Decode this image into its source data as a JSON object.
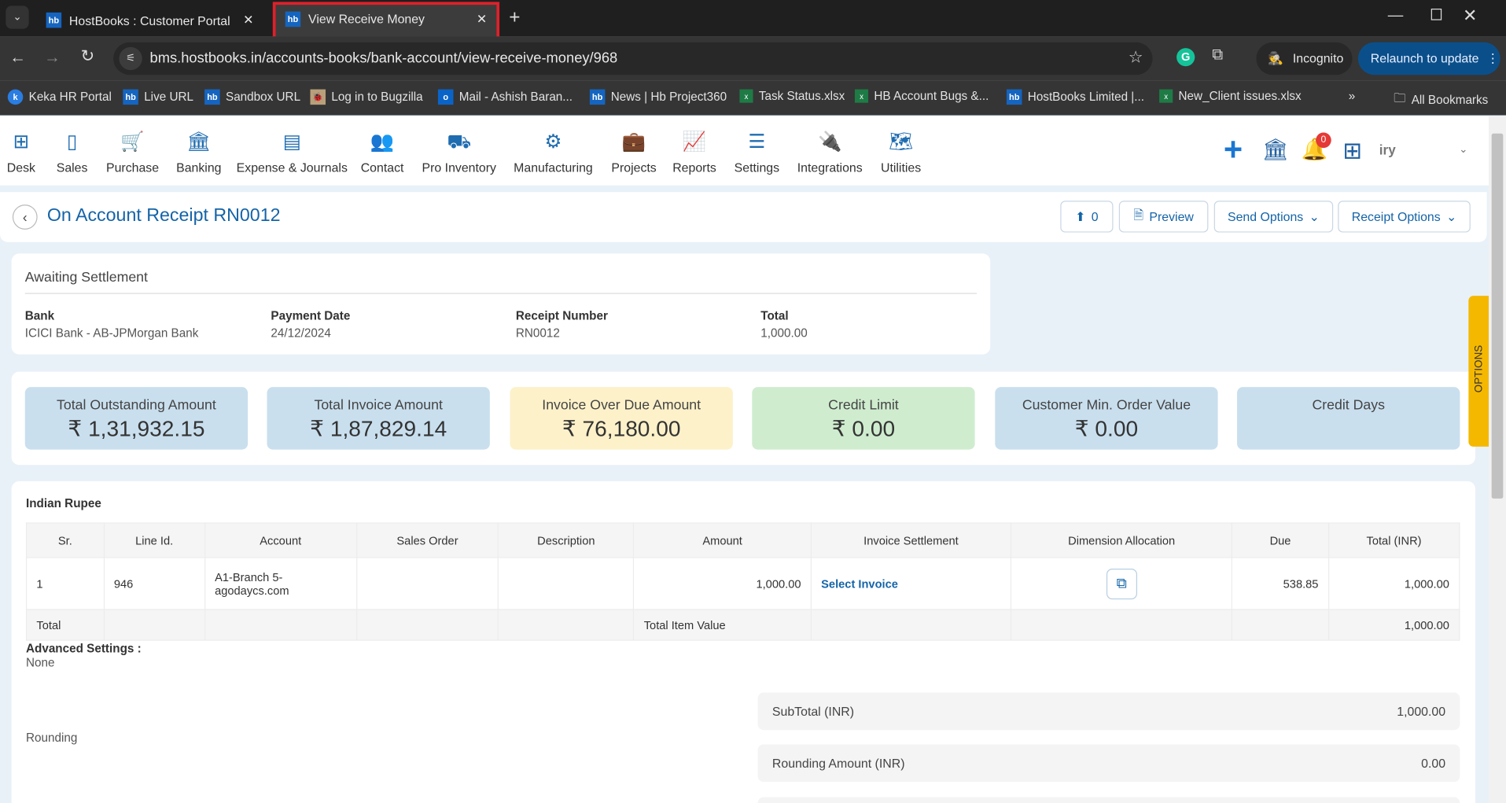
{
  "browser": {
    "tabs": [
      {
        "title": "HostBooks : Customer Portal",
        "active": false
      },
      {
        "title": "View Receive Money",
        "active": true
      }
    ],
    "url": "bms.hostbooks.in/accounts-books/bank-account/view-receive-money/968",
    "incognito": "Incognito",
    "relaunch": "Relaunch to update",
    "bookmarks": [
      "Keka HR Portal",
      "Live URL",
      "Sandbox URL",
      "Log in to Bugzilla",
      "Mail - Ashish Baran...",
      "News | Hb Project360",
      "Task Status.xlsx",
      "HB Account Bugs &...",
      "HostBooks Limited |...",
      "New_Client issues.xlsx"
    ],
    "all_bookmarks": "All Bookmarks"
  },
  "nav": {
    "items": [
      "Desk",
      "Sales",
      "Purchase",
      "Banking",
      "Expense & Journals",
      "Contact",
      "Pro Inventory",
      "Manufacturing",
      "Projects",
      "Reports",
      "Settings",
      "Integrations",
      "Utilities"
    ],
    "notifications": "0",
    "user": "iry"
  },
  "header": {
    "title": "On Account Receipt RN0012",
    "attach_count": "0",
    "preview": "Preview",
    "send_options": "Send Options",
    "receipt_options": "Receipt Options"
  },
  "status": {
    "title": "Awaiting Settlement",
    "fields": [
      {
        "label": "Bank",
        "value": "ICICI Bank - AB-JPMorgan Bank"
      },
      {
        "label": "Payment Date",
        "value": "24/12/2024"
      },
      {
        "label": "Receipt Number",
        "value": "RN0012"
      },
      {
        "label": "Total",
        "value": "1,000.00"
      }
    ]
  },
  "summary": [
    {
      "label": "Total Outstanding Amount",
      "value": "₹ 1,31,932.15",
      "color": "#c9dfee"
    },
    {
      "label": "Total Invoice Amount",
      "value": "₹ 1,87,829.14",
      "color": "#c9dfee"
    },
    {
      "label": "Invoice Over Due Amount",
      "value": "₹ 76,180.00",
      "color": "#fdf1c9"
    },
    {
      "label": "Credit Limit",
      "value": "₹ 0.00",
      "color": "#cfeccf"
    },
    {
      "label": "Customer Min. Order Value",
      "value": "₹ 0.00",
      "color": "#c9dfee"
    },
    {
      "label": "Credit Days",
      "value": "",
      "color": "#c9dfee"
    }
  ],
  "options_tab": "OPTIONS",
  "currency": "Indian Rupee",
  "table": {
    "columns": [
      "Sr.",
      "Line Id.",
      "Account",
      "Sales Order",
      "Description",
      "Amount",
      "Invoice Settlement",
      "Dimension Allocation",
      "Due",
      "Total (INR)"
    ],
    "rows": [
      {
        "sr": "1",
        "line_id": "946",
        "account": "A1-Branch 5-agodaycs.com",
        "sales_order": "",
        "description": "",
        "amount": "1,000.00",
        "invoice_settlement": "Select Invoice",
        "due": "538.85",
        "total": "1,000.00"
      }
    ],
    "footer": {
      "label": "Total",
      "item_value_label": "Total Item Value",
      "total": "1,000.00"
    }
  },
  "advanced": {
    "label": "Advanced Settings :",
    "value": "None"
  },
  "rounding_label": "Rounding",
  "totals": [
    {
      "label": "SubTotal (INR)",
      "value": "1,000.00"
    },
    {
      "label": "Rounding Amount (INR)",
      "value": "0.00"
    }
  ]
}
